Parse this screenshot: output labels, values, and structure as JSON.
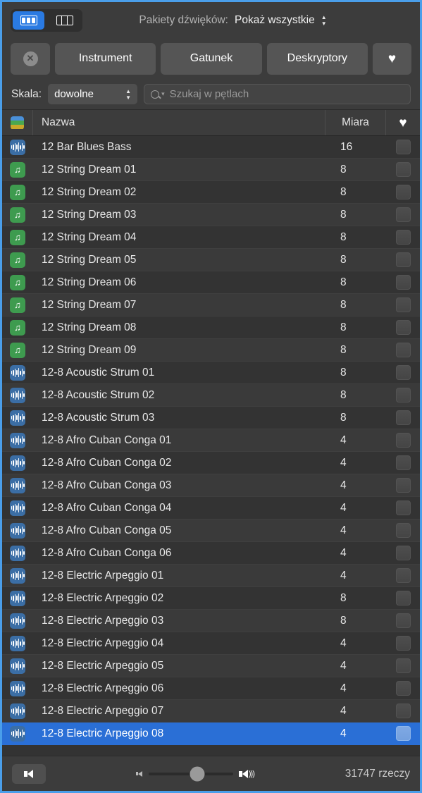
{
  "window": {
    "accent_border": "#4a9eea"
  },
  "toolbar": {
    "view_modes": [
      {
        "name": "grid-view",
        "icon": "columns-filled-icon",
        "active": true
      },
      {
        "name": "column-view",
        "icon": "columns-outline-icon",
        "active": false
      }
    ],
    "packs_label": "Pakiety dźwięków:",
    "packs_value": "Pokaż wszystkie"
  },
  "filters": {
    "clear_icon": "clear-x-icon",
    "buttons": [
      {
        "label": "Instrument"
      },
      {
        "label": "Gatunek"
      },
      {
        "label": "Deskryptory"
      }
    ],
    "favorites_icon": "heart-icon"
  },
  "scale": {
    "label": "Skala:",
    "value": "dowolne"
  },
  "search": {
    "placeholder": "Szukaj w pętlach",
    "value": "",
    "icon": "search-icon"
  },
  "table": {
    "header": {
      "type_icon": "color-stack-icon",
      "name": "Nazwa",
      "measure": "Miara",
      "favorite_icon": "heart-icon"
    },
    "rows": [
      {
        "type": "audio",
        "name": "12 Bar Blues Bass",
        "measure": "16",
        "favorite": false,
        "selected": false
      },
      {
        "type": "midi",
        "name": "12 String Dream 01",
        "measure": "8",
        "favorite": false,
        "selected": false
      },
      {
        "type": "midi",
        "name": "12 String Dream 02",
        "measure": "8",
        "favorite": false,
        "selected": false
      },
      {
        "type": "midi",
        "name": "12 String Dream 03",
        "measure": "8",
        "favorite": false,
        "selected": false
      },
      {
        "type": "midi",
        "name": "12 String Dream 04",
        "measure": "8",
        "favorite": false,
        "selected": false
      },
      {
        "type": "midi",
        "name": "12 String Dream 05",
        "measure": "8",
        "favorite": false,
        "selected": false
      },
      {
        "type": "midi",
        "name": "12 String Dream 06",
        "measure": "8",
        "favorite": false,
        "selected": false
      },
      {
        "type": "midi",
        "name": "12 String Dream 07",
        "measure": "8",
        "favorite": false,
        "selected": false
      },
      {
        "type": "midi",
        "name": "12 String Dream 08",
        "measure": "8",
        "favorite": false,
        "selected": false
      },
      {
        "type": "midi",
        "name": "12 String Dream 09",
        "measure": "8",
        "favorite": false,
        "selected": false
      },
      {
        "type": "audio",
        "name": "12-8 Acoustic Strum 01",
        "measure": "8",
        "favorite": false,
        "selected": false
      },
      {
        "type": "audio",
        "name": "12-8 Acoustic Strum 02",
        "measure": "8",
        "favorite": false,
        "selected": false
      },
      {
        "type": "audio",
        "name": "12-8 Acoustic Strum 03",
        "measure": "8",
        "favorite": false,
        "selected": false
      },
      {
        "type": "audio",
        "name": "12-8 Afro Cuban Conga 01",
        "measure": "4",
        "favorite": false,
        "selected": false
      },
      {
        "type": "audio",
        "name": "12-8 Afro Cuban Conga 02",
        "measure": "4",
        "favorite": false,
        "selected": false
      },
      {
        "type": "audio",
        "name": "12-8 Afro Cuban Conga 03",
        "measure": "4",
        "favorite": false,
        "selected": false
      },
      {
        "type": "audio",
        "name": "12-8 Afro Cuban Conga 04",
        "measure": "4",
        "favorite": false,
        "selected": false
      },
      {
        "type": "audio",
        "name": "12-8 Afro Cuban Conga 05",
        "measure": "4",
        "favorite": false,
        "selected": false
      },
      {
        "type": "audio",
        "name": "12-8 Afro Cuban Conga 06",
        "measure": "4",
        "favorite": false,
        "selected": false
      },
      {
        "type": "audio",
        "name": "12-8 Electric Arpeggio 01",
        "measure": "4",
        "favorite": false,
        "selected": false
      },
      {
        "type": "audio",
        "name": "12-8 Electric Arpeggio 02",
        "measure": "8",
        "favorite": false,
        "selected": false
      },
      {
        "type": "audio",
        "name": "12-8 Electric Arpeggio 03",
        "measure": "8",
        "favorite": false,
        "selected": false
      },
      {
        "type": "audio",
        "name": "12-8 Electric Arpeggio 04",
        "measure": "4",
        "favorite": false,
        "selected": false
      },
      {
        "type": "audio",
        "name": "12-8 Electric Arpeggio 05",
        "measure": "4",
        "favorite": false,
        "selected": false
      },
      {
        "type": "audio",
        "name": "12-8 Electric Arpeggio 06",
        "measure": "4",
        "favorite": false,
        "selected": false
      },
      {
        "type": "audio",
        "name": "12-8 Electric Arpeggio 07",
        "measure": "4",
        "favorite": false,
        "selected": false
      },
      {
        "type": "audio",
        "name": "12-8 Electric Arpeggio 08",
        "measure": "4",
        "favorite": false,
        "selected": true
      }
    ]
  },
  "bottom": {
    "preview_icon": "speaker-play-icon",
    "volume_low_icon": "speaker-low-icon",
    "volume_high_icon": "speaker-high-icon",
    "volume_percent": 58,
    "count_text": "31747 rzeczy"
  }
}
